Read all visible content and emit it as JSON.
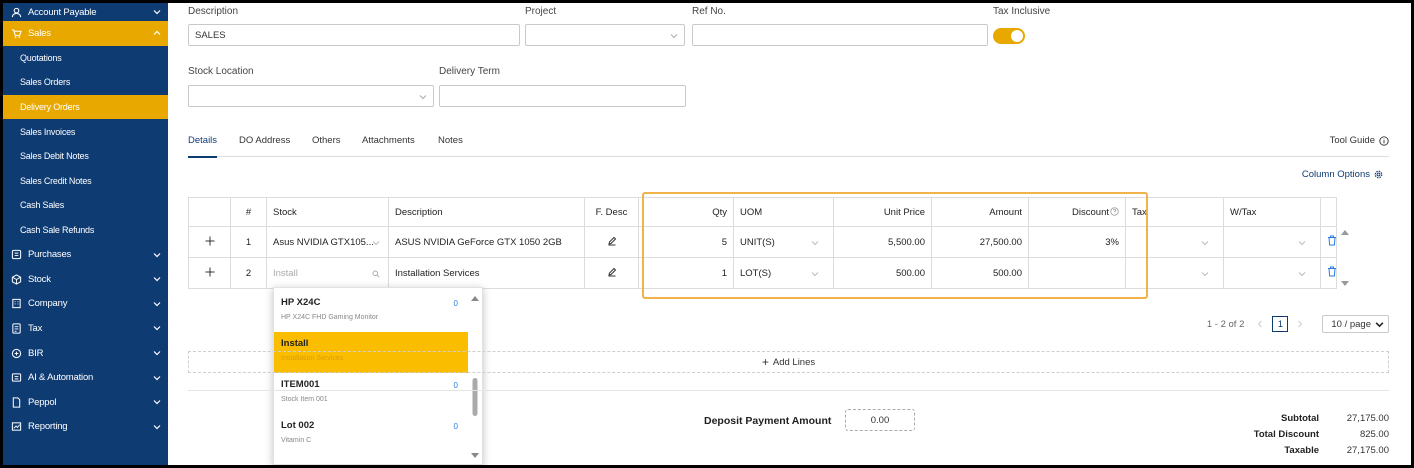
{
  "sidebar": {
    "items": [
      {
        "label": "Account Payable",
        "icon": "account-payable-icon"
      },
      {
        "label": "Sales",
        "icon": "sales-icon"
      },
      {
        "label": "Quotations"
      },
      {
        "label": "Sales Orders"
      },
      {
        "label": "Delivery Orders"
      },
      {
        "label": "Sales Invoices"
      },
      {
        "label": "Sales Debit Notes"
      },
      {
        "label": "Sales Credit Notes"
      },
      {
        "label": "Cash Sales"
      },
      {
        "label": "Cash Sale Refunds"
      },
      {
        "label": "Purchases",
        "icon": "purchases-icon"
      },
      {
        "label": "Stock",
        "icon": "stock-icon"
      },
      {
        "label": "Company",
        "icon": "company-icon"
      },
      {
        "label": "Tax",
        "icon": "tax-icon"
      },
      {
        "label": "BIR",
        "icon": "bir-icon"
      },
      {
        "label": "AI & Automation",
        "icon": "ai-icon"
      },
      {
        "label": "Peppol",
        "icon": "peppol-icon"
      },
      {
        "label": "Reporting",
        "icon": "reporting-icon"
      }
    ],
    "active_section": "Sales",
    "active_item": "Delivery Orders"
  },
  "form": {
    "description_label": "Description",
    "description_value": "SALES",
    "project_label": "Project",
    "ref_label": "Ref No.",
    "tax_inclusive_label": "Tax Inclusive",
    "stock_location_label": "Stock Location",
    "delivery_term_label": "Delivery Term"
  },
  "tabs": [
    "Details",
    "DO Address",
    "Others",
    "Attachments",
    "Notes"
  ],
  "tool_guide": "Tool Guide",
  "column_options": "Column Options",
  "table": {
    "headers": {
      "num": "#",
      "stock": "Stock",
      "description": "Description",
      "fdesc": "F. Desc",
      "qty": "Qty",
      "uom": "UOM",
      "unit_price": "Unit Price",
      "amount": "Amount",
      "discount": "Discount",
      "tax": "Tax",
      "wtax": "W/Tax"
    },
    "rows": [
      {
        "num": "1",
        "stock": "Asus NVIDIA GTX105...",
        "description": "ASUS NVIDIA GeForce GTX 1050 2GB",
        "qty": "5",
        "uom": "UNIT(S)",
        "unit_price": "5,500.00",
        "amount": "27,500.00",
        "discount": "3%"
      },
      {
        "num": "2",
        "stock": "Install",
        "description": "Installation Services",
        "qty": "1",
        "uom": "LOT(S)",
        "unit_price": "500.00",
        "amount": "500.00",
        "discount": ""
      }
    ]
  },
  "dropdown": {
    "options": [
      {
        "code": "HP X24C",
        "desc": "HP X24C FHD Gaming Monitor",
        "qty": "0"
      },
      {
        "code": "Install",
        "desc": "Installation Services",
        "qty": ""
      },
      {
        "code": "ITEM001",
        "desc": "Stock Item 001",
        "qty": "0"
      },
      {
        "code": "Lot 002",
        "desc": "Vitamin C",
        "qty": "0"
      }
    ],
    "selected": "Install"
  },
  "pager": {
    "range": "1 - 2 of 2",
    "page": "1",
    "page_size": "10 / page"
  },
  "add_lines": "Add Lines",
  "deposit": {
    "label": "Deposit Payment Amount",
    "value": "0.00"
  },
  "totals": [
    {
      "label": "Subtotal",
      "value": "27,175.00"
    },
    {
      "label": "Total Discount",
      "value": "825.00"
    },
    {
      "label": "Taxable",
      "value": "27,175.00"
    }
  ],
  "colors": {
    "sidebar_bg": "#0f3b73",
    "accent": "#e8a800",
    "highlight": "#f0b24b"
  }
}
